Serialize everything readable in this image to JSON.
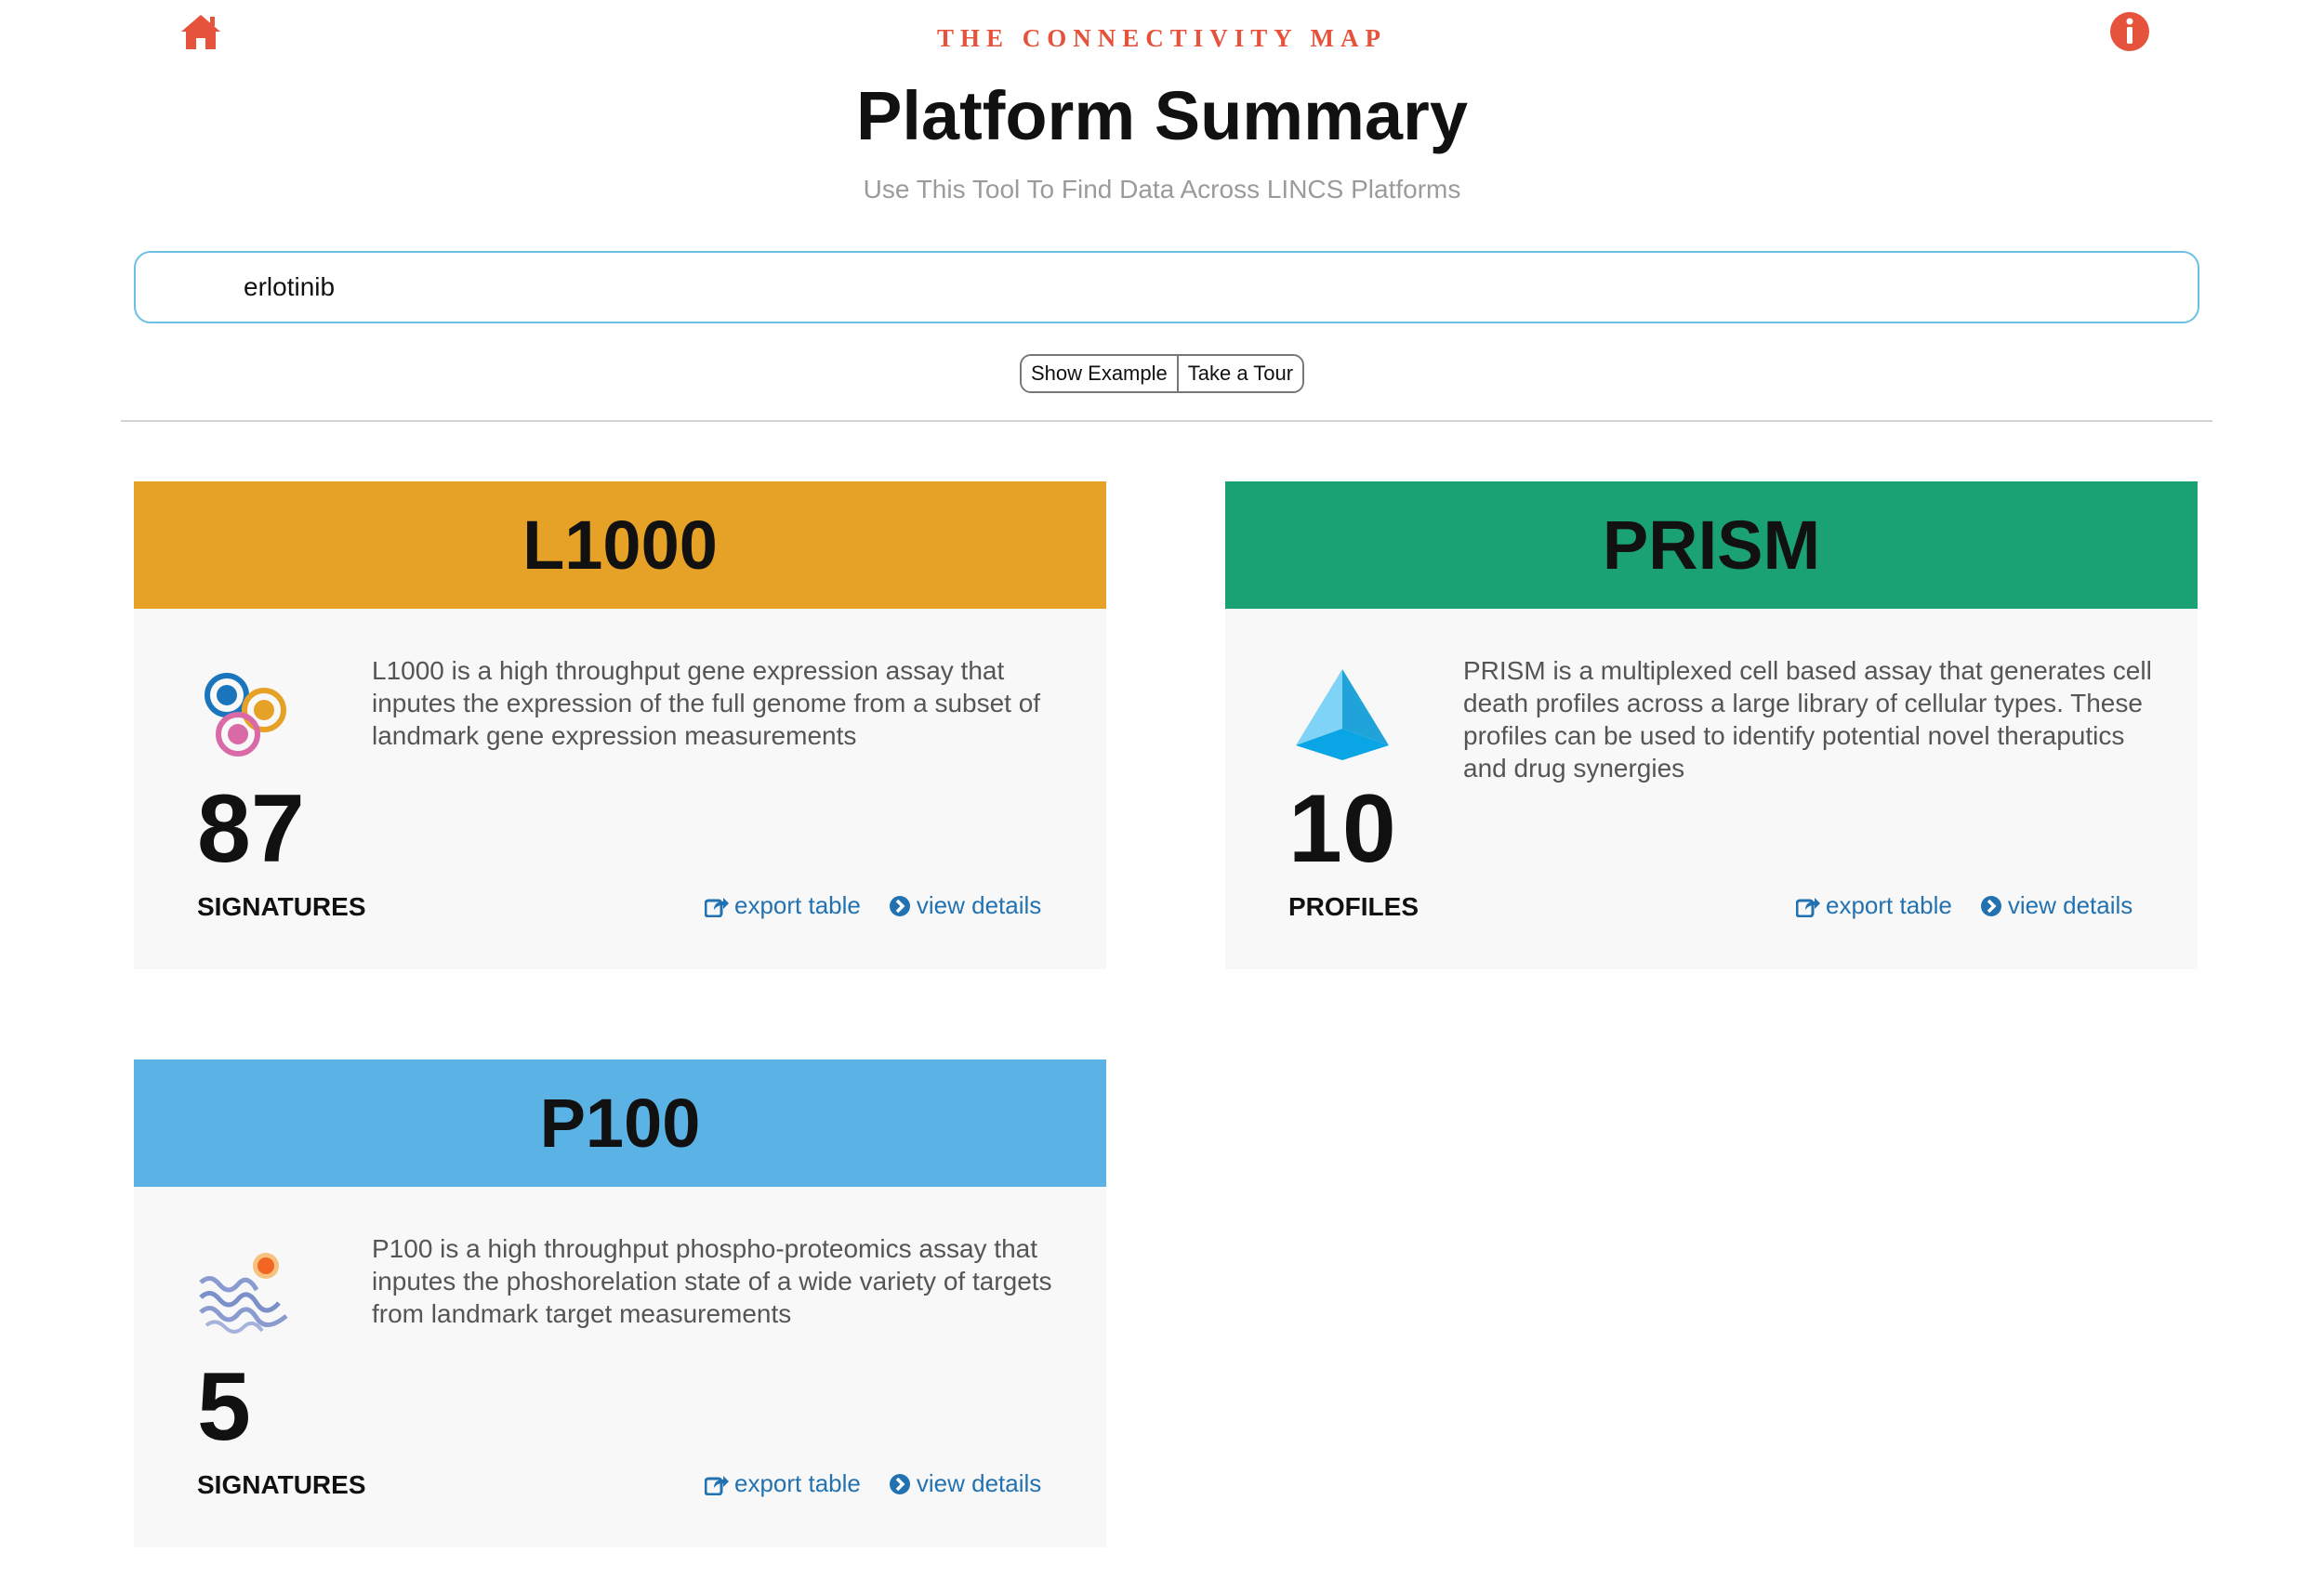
{
  "header": {
    "brand": "THE CONNECTIVITY MAP",
    "title": "Platform Summary",
    "subtitle": "Use This Tool To Find Data Across LINCS Platforms",
    "home_icon": "home-icon",
    "info_icon": "info-icon",
    "accent_color": "#e5533c"
  },
  "search": {
    "value": "erlotinib"
  },
  "actions": {
    "show_example": "Show Example",
    "take_tour": "Take a Tour"
  },
  "platforms": [
    {
      "name": "L1000",
      "color": "#e6a127",
      "icon": "l1000-circles-icon",
      "description": "L1000 is a high throughput gene expression assay that inputes the expression of the full genome from a subset of landmark gene expression measurements",
      "count": "87",
      "unit": "SIGNATURES",
      "export_label": "export table",
      "details_label": "view details"
    },
    {
      "name": "PRISM",
      "color": "#1ba274",
      "icon": "prism-pyramid-icon",
      "description": "PRISM is a multiplexed cell based assay that generates cell death profiles across a large library of cellular types.  These profiles can be used to identify potential novel theraputics and drug synergies",
      "count": "10",
      "unit": "PROFILES",
      "export_label": "export table",
      "details_label": "view details"
    },
    {
      "name": "P100",
      "color": "#5ab3e4",
      "icon": "p100-wave-icon",
      "description": "P100 is a high throughput phospho-proteomics assay that inputes the phoshorelation state of a wide variety of targets from landmark target measurements",
      "count": "5",
      "unit": "SIGNATURES",
      "export_label": "export table",
      "details_label": "view details"
    }
  ]
}
